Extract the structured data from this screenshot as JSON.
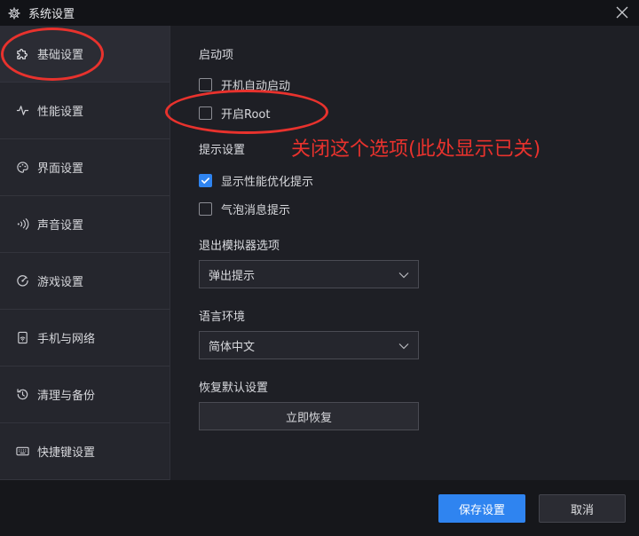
{
  "window": {
    "title": "系统设置",
    "icon": "gear-icon",
    "close_icon": "close-icon"
  },
  "sidebar": {
    "items": [
      {
        "label": "基础设置",
        "icon": "puzzle-icon",
        "active": true
      },
      {
        "label": "性能设置",
        "icon": "pulse-icon",
        "active": false
      },
      {
        "label": "界面设置",
        "icon": "palette-icon",
        "active": false
      },
      {
        "label": "声音设置",
        "icon": "sound-icon",
        "active": false
      },
      {
        "label": "游戏设置",
        "icon": "game-icon",
        "active": false
      },
      {
        "label": "手机与网络",
        "icon": "network-icon",
        "active": false
      },
      {
        "label": "清理与备份",
        "icon": "history-icon",
        "active": false
      },
      {
        "label": "快捷键设置",
        "icon": "keyboard-icon",
        "active": false
      }
    ]
  },
  "main": {
    "startup": {
      "title": "启动项",
      "options": [
        {
          "label": "开机自动启动",
          "checked": false
        },
        {
          "label": "开启Root",
          "checked": false
        }
      ]
    },
    "hints": {
      "title": "提示设置",
      "options": [
        {
          "label": "显示性能优化提示",
          "checked": true
        },
        {
          "label": "气泡消息提示",
          "checked": false
        }
      ]
    },
    "exit_option": {
      "title": "退出模拟器选项",
      "value": "弹出提示"
    },
    "language": {
      "title": "语言环境",
      "value": "简体中文"
    },
    "restore": {
      "title": "恢复默认设置",
      "button": "立即恢复"
    }
  },
  "footer": {
    "save": "保存设置",
    "cancel": "取消"
  },
  "annotation": {
    "text": "关闭这个选项(此处显示已关)",
    "color": "#e8322d"
  },
  "colors": {
    "accent": "#2f84f0",
    "background": "#1e1f25",
    "sidebar": "#25262d",
    "titlebar": "#121317"
  }
}
